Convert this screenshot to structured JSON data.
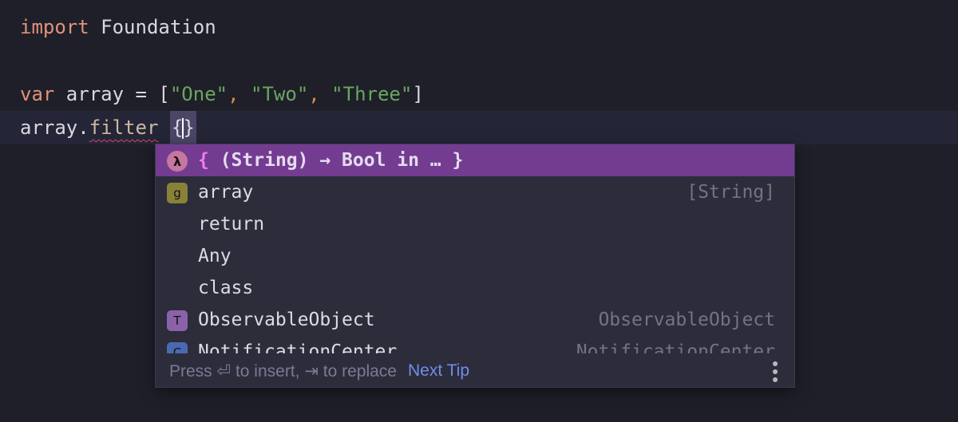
{
  "editor": {
    "lines": [
      {
        "keyword": "import",
        "rest": " Foundation"
      },
      {
        "empty": true
      },
      {
        "keyword": "var",
        "decl": " array = [",
        "strings": [
          "\"One\"",
          "\"Two\"",
          "\"Three\""
        ],
        "comma": ",",
        "close": "]"
      },
      {
        "receiver": "array.",
        "method": "filter",
        "space": " ",
        "placeholder_open": "{",
        "placeholder_close": "}"
      }
    ]
  },
  "completion": {
    "items": [
      {
        "icon": "closure-icon",
        "badge": "λ",
        "brace_open": "{",
        "label": " (String) → Bool in … ",
        "brace_close": "}",
        "type": "",
        "selected": true
      },
      {
        "icon": "global-variable-icon",
        "badge": "g",
        "label": "array",
        "type": "[String]"
      },
      {
        "icon": "",
        "badge": "",
        "label": "return",
        "type": ""
      },
      {
        "icon": "",
        "badge": "",
        "label": "Any",
        "type": ""
      },
      {
        "icon": "",
        "badge": "",
        "label": "class",
        "type": ""
      },
      {
        "icon": "type-icon",
        "badge": "T",
        "label": "ObservableObject",
        "type": "ObservableObject"
      },
      {
        "icon": "class-icon",
        "badge": "C",
        "label": "NotificationCenter",
        "type": "NotificationCenter"
      }
    ],
    "footer": {
      "hint": "Press ⏎ to insert, ⇥ to replace",
      "next_tip": "Next Tip",
      "more_icon": "more-vertical-icon"
    }
  }
}
